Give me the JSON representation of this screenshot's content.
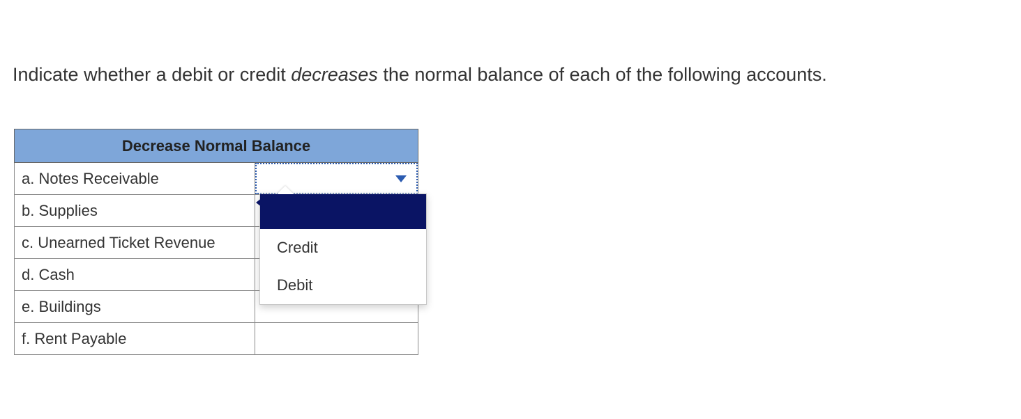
{
  "instruction": {
    "pre": "Indicate whether a debit or credit ",
    "italic": "decreases",
    "post": " the normal balance of each of the following accounts."
  },
  "table": {
    "header": "Decrease Normal Balance",
    "rows": [
      {
        "label": "a. Notes Receivable",
        "value": "",
        "active": true
      },
      {
        "label": "b. Supplies",
        "value": ""
      },
      {
        "label": "c. Unearned Ticket Revenue",
        "value": ""
      },
      {
        "label": "d. Cash",
        "value": ""
      },
      {
        "label": "e. Buildings",
        "value": ""
      },
      {
        "label": "f. Rent Payable",
        "value": ""
      }
    ]
  },
  "dropdown": {
    "options": [
      {
        "label": "",
        "highlighted": true
      },
      {
        "label": "Credit"
      },
      {
        "label": "Debit"
      }
    ]
  }
}
